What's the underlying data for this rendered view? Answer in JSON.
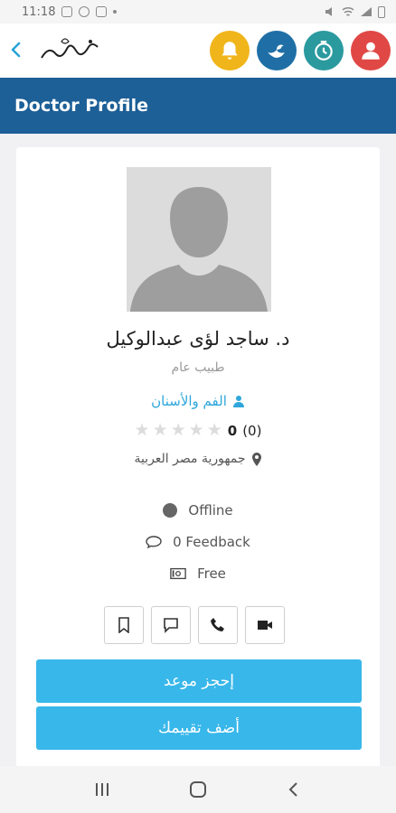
{
  "status_bar": {
    "time": "11:18"
  },
  "header": {
    "back_icon": "chevron-left-icon",
    "logo_text": "ﺍﻟﻤﺠﺪ",
    "icons": [
      "bell-icon",
      "bird-icon",
      "clock-icon",
      "user-icon"
    ],
    "colors": {
      "bell": "#f0b51a",
      "bird": "#1f6fa6",
      "clock": "#2a9a9f",
      "user": "#e04846"
    }
  },
  "title_bar": {
    "title": "Doctor Profile",
    "color": "#1d5f97"
  },
  "profile": {
    "name": "د. ساجد لؤى عبدالوكيل",
    "title": "طبيب عام",
    "specialty": "الفم والأسنان",
    "rating_value": "0",
    "rating_count": "(0)",
    "stars_filled": 0,
    "stars_total": 5,
    "location": "جمهورية مصر العربية",
    "status": "Offline",
    "feedback": "0 Feedback",
    "fee": "Free"
  },
  "actions": {
    "icons": [
      "bookmark-icon",
      "chat-icon",
      "phone-icon",
      "video-icon"
    ]
  },
  "buttons": {
    "book": "إحجز موعد",
    "review": "أضف تقييمك",
    "color": "#38b7ea"
  },
  "nav": {
    "icons": [
      "recent-apps-icon",
      "home-icon",
      "back-icon"
    ]
  }
}
